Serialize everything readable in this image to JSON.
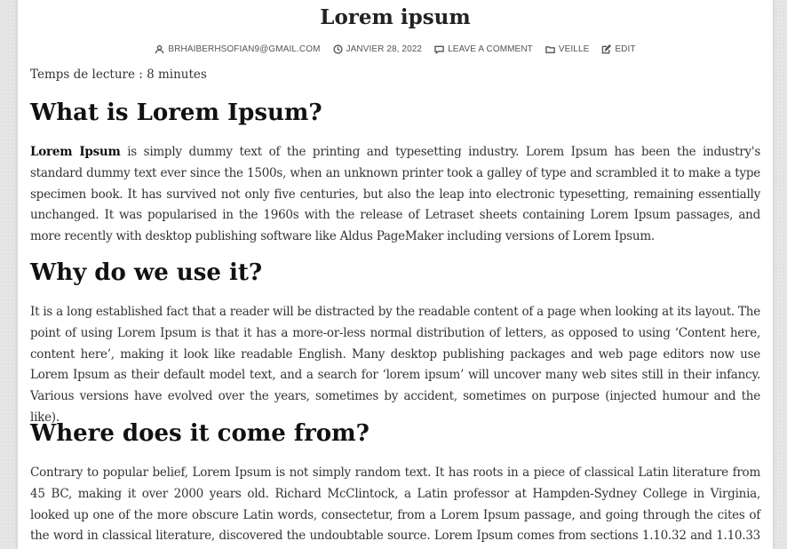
{
  "post": {
    "title": "Lorem ipsum",
    "meta": {
      "author": "BRHAIBERHSOFIAN9@GMAIL.COM",
      "date": "JANVIER 28, 2022",
      "comments": "LEAVE A COMMENT",
      "category": "VEILLE",
      "edit": "EDIT"
    },
    "reading_time": "Temps de lecture : 8 minutes",
    "sections": [
      {
        "heading": "What is Lorem Ipsum?",
        "strong": "Lorem Ipsum",
        "text": " is simply dummy text of the printing and typesetting industry. Lorem Ipsum has been the industry's standard dummy text ever since the 1500s, when an unknown printer took a galley of type and scrambled it to make a type specimen book. It has survived not only five centuries, but also the leap into electronic typesetting, remaining essentially unchanged. It was popularised in the 1960s with the release of Letraset sheets containing Lorem Ipsum passages, and more recently with desktop publishing software like Aldus PageMaker including versions of Lorem Ipsum."
      },
      {
        "heading": "Why do we use it?",
        "text": "It is a long established fact that a reader will be distracted by the readable content of a page when looking at its layout. The point of using Lorem Ipsum is that it has a more-or-less normal distribution of letters, as opposed to using ‘Content here, content here’, making it look like readable English. Many desktop publishing packages and web page editors now use Lorem Ipsum as their default model text, and a search for ‘lorem ipsum’ will uncover many web sites still in their infancy. Various versions have evolved over the years, sometimes by accident, sometimes on purpose (injected humour and the like)."
      },
      {
        "heading": "Where does it come from?",
        "text": "Contrary to popular belief, Lorem Ipsum is not simply random text. It has roots in a piece of classical Latin literature from 45 BC, making it over 2000 years old. Richard McClintock, a Latin professor at Hampden-Sydney College in Virginia, looked up one of the more obscure Latin words, consectetur, from a Lorem Ipsum passage, and going through the cites of the word in classical literature, discovered the undoubtable source. Lorem Ipsum comes from sections 1.10.32 and 1.10.33 of « de Finibus"
      }
    ]
  }
}
